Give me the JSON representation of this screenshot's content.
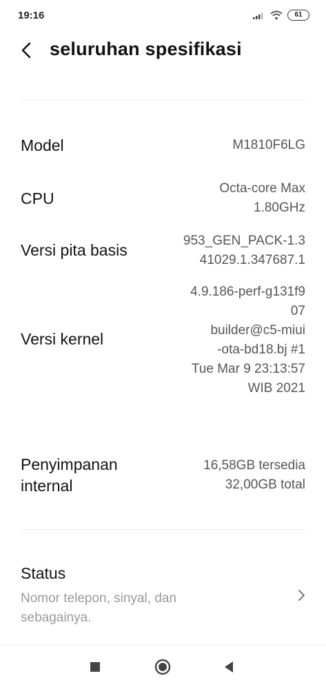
{
  "status_bar": {
    "time": "19:16",
    "battery": "61"
  },
  "header": {
    "title": "seluruhan spesifikasi"
  },
  "specs": [
    {
      "label": "Model",
      "value": "M1810F6LG"
    },
    {
      "label": "CPU",
      "value": "Octa-core Max\n1.80GHz"
    },
    {
      "label": "Versi pita basis",
      "value": "953_GEN_PACK-1.3\n41029.1.347687.1"
    },
    {
      "label": "Versi kernel",
      "value": "4.9.186-perf-g131f9\n07\nbuilder@c5-miui\n-ota-bd18.bj #1\nTue Mar 9 23:13:57\nWIB 2021"
    },
    {
      "label": "Penyimpanan\ninternal",
      "value": "16,58GB tersedia\n32,00GB total"
    }
  ],
  "status_item": {
    "label": "Status",
    "description": "Nomor telepon, sinyal, dan sebagainya."
  },
  "icons": {
    "back": "back-arrow-icon",
    "chevron": "chevron-right-icon",
    "nav_recent": "recent-apps-icon",
    "nav_home": "home-icon",
    "nav_back": "nav-back-icon",
    "signal": "signal-icon",
    "wifi": "wifi-icon"
  }
}
